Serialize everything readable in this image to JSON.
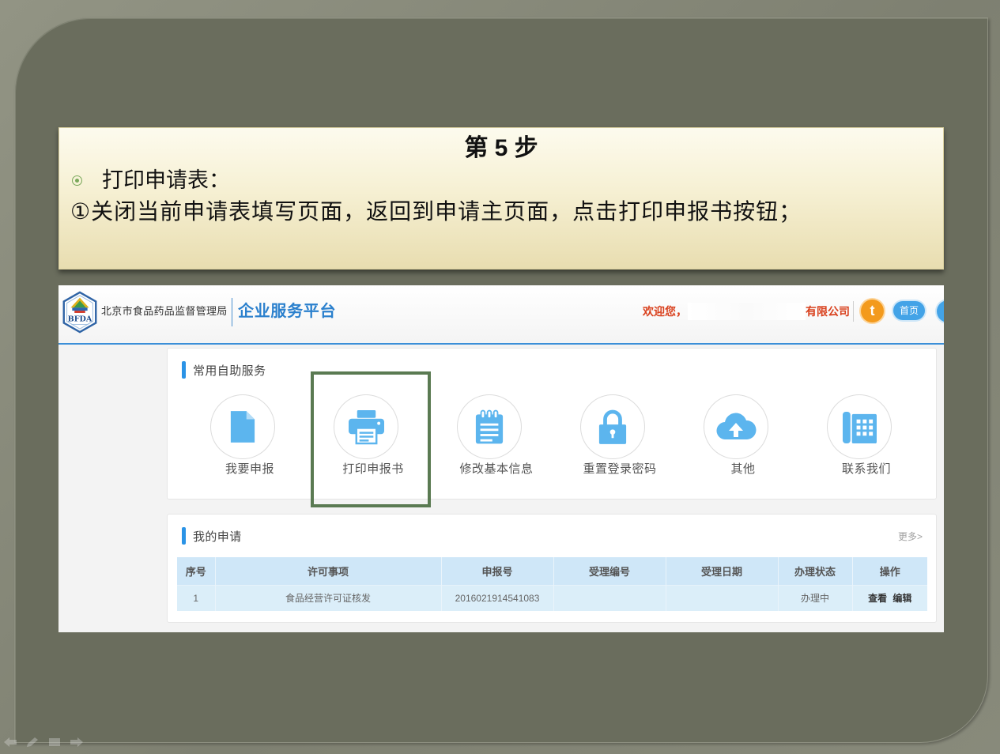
{
  "slide": {
    "step_title": "第 5 步",
    "bullet_label": "打印申请表：",
    "instruction": "①关闭当前申请表填写页面，返回到申请主页面，点击打印申报书按钮；"
  },
  "portal": {
    "header": {
      "logo_text": "BFDA",
      "org_name": "北京市食品药品监督管理局",
      "platform_name": "企业服务平台",
      "welcome": "欢迎您，",
      "company_suffix": "有限公司",
      "user_icon_letter": "t",
      "home_label": "首页"
    },
    "services": {
      "title": "常用自助服务",
      "items": [
        {
          "label": "我要申报",
          "icon": "document-icon"
        },
        {
          "label": "打印申报书",
          "icon": "printer-icon",
          "highlighted": true
        },
        {
          "label": "修改基本信息",
          "icon": "notepad-icon"
        },
        {
          "label": "重置登录密码",
          "icon": "lock-icon"
        },
        {
          "label": "其他",
          "icon": "cloud-upload-icon"
        },
        {
          "label": "联系我们",
          "icon": "phone-icon"
        }
      ]
    },
    "applications": {
      "title": "我的申请",
      "more_label": "更多>",
      "columns": [
        "序号",
        "许可事项",
        "申报号",
        "受理编号",
        "受理日期",
        "办理状态",
        "操作"
      ],
      "rows": [
        {
          "index": "1",
          "permit_item": "食品经营许可证核发",
          "application_no": "2016021914541083",
          "acceptance_no": "",
          "acceptance_date": "",
          "status": "办理中",
          "actions": [
            "查看",
            "编辑"
          ]
        }
      ]
    }
  },
  "slideshow_controls": [
    "prev-slide-icon",
    "pen-tool-icon",
    "slide-menu-icon",
    "next-slide-icon"
  ],
  "colors": {
    "slide_panel": "#6a6d5d",
    "callout_top": "#fdfbee",
    "callout_bottom": "#e8ddb0",
    "bullet_green": "#79a85a",
    "highlight_green": "#5a7a52",
    "accent_blue": "#2b80cd",
    "header_rule_blue": "#3b8fd8",
    "icon_blue": "#5cb5ee",
    "welcome_red": "#d9411e",
    "user_icon_orange": "#f39a1d",
    "table_header_bg": "#cfe7f8",
    "table_row_bg": "#dbeef9"
  }
}
